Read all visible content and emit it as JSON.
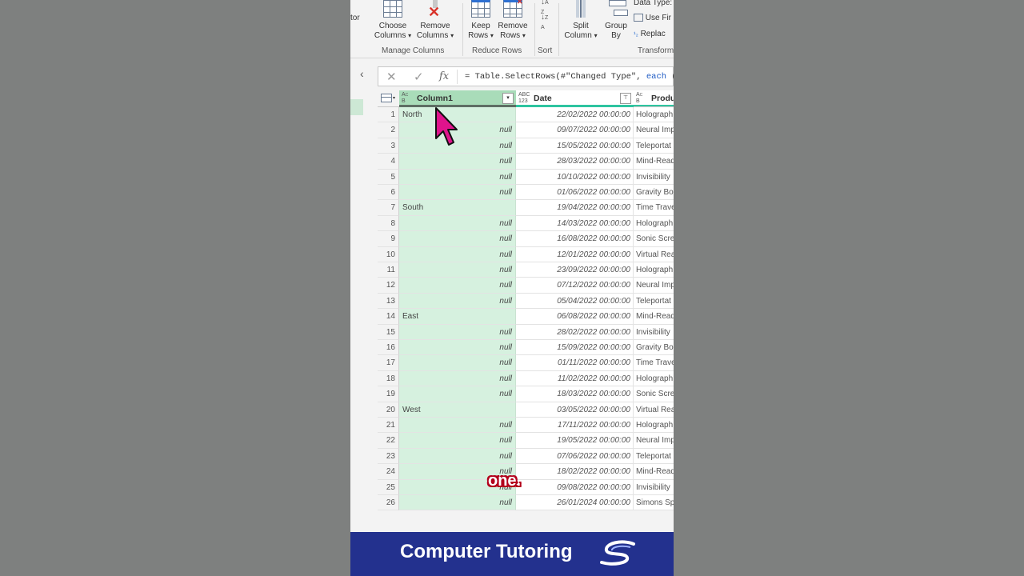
{
  "ribbon": {
    "partial_left": "tor",
    "choose_columns": [
      "Choose",
      "Columns"
    ],
    "remove_columns": [
      "Remove",
      "Columns"
    ],
    "keep_rows": [
      "Keep",
      "Rows"
    ],
    "remove_rows": [
      "Remove",
      "Rows"
    ],
    "split_column": [
      "Split",
      "Column"
    ],
    "group_by": [
      "Group",
      "By"
    ],
    "data_type": "Data Type:",
    "use_first": "Use Fir",
    "replace": "Replac",
    "groups": {
      "manage_columns": "Manage Columns",
      "reduce_rows": "Reduce Rows",
      "sort": "Sort",
      "transform": "Transform"
    }
  },
  "formula": {
    "prefix": "= Table.SelectRows(#\"Changed Type\", ",
    "keyword": "each",
    "suffix": " ("
  },
  "columns": {
    "col1": {
      "type_top": "A",
      "type_bottom": "B",
      "type_mid": "C",
      "name": "Column1"
    },
    "date": {
      "type_top": "ABC",
      "type_bottom": "123",
      "name": "Date"
    },
    "product": {
      "type_top": "A",
      "type_bottom": "B",
      "type_mid": "C",
      "name": "Produ"
    }
  },
  "rows": [
    {
      "n": "1",
      "region": "North",
      "date": "22/02/2022 00:00:00",
      "product": "Holograph"
    },
    {
      "n": "2",
      "region": null,
      "date": "09/07/2022 00:00:00",
      "product": "Neural Imp"
    },
    {
      "n": "3",
      "region": null,
      "date": "15/05/2022 00:00:00",
      "product": "Teleportat"
    },
    {
      "n": "4",
      "region": null,
      "date": "28/03/2022 00:00:00",
      "product": "Mind-Read"
    },
    {
      "n": "5",
      "region": null,
      "date": "10/10/2022 00:00:00",
      "product": "Invisibility"
    },
    {
      "n": "6",
      "region": null,
      "date": "01/06/2022 00:00:00",
      "product": "Gravity Bo"
    },
    {
      "n": "7",
      "region": "South",
      "date": "19/04/2022 00:00:00",
      "product": "Time Trave"
    },
    {
      "n": "8",
      "region": null,
      "date": "14/03/2022 00:00:00",
      "product": "Holograph"
    },
    {
      "n": "9",
      "region": null,
      "date": "16/08/2022 00:00:00",
      "product": "Sonic Scre"
    },
    {
      "n": "10",
      "region": null,
      "date": "12/01/2022 00:00:00",
      "product": "Virtual Rea"
    },
    {
      "n": "11",
      "region": null,
      "date": "23/09/2022 00:00:00",
      "product": "Holograph"
    },
    {
      "n": "12",
      "region": null,
      "date": "07/12/2022 00:00:00",
      "product": "Neural Imp"
    },
    {
      "n": "13",
      "region": null,
      "date": "05/04/2022 00:00:00",
      "product": "Teleportat"
    },
    {
      "n": "14",
      "region": "East",
      "date": "06/08/2022 00:00:00",
      "product": "Mind-Read"
    },
    {
      "n": "15",
      "region": null,
      "date": "28/02/2022 00:00:00",
      "product": "Invisibility"
    },
    {
      "n": "16",
      "region": null,
      "date": "15/09/2022 00:00:00",
      "product": "Gravity Bo"
    },
    {
      "n": "17",
      "region": null,
      "date": "01/11/2022 00:00:00",
      "product": "Time Trave"
    },
    {
      "n": "18",
      "region": null,
      "date": "11/02/2022 00:00:00",
      "product": "Holograph"
    },
    {
      "n": "19",
      "region": null,
      "date": "18/03/2022 00:00:00",
      "product": "Sonic Scre"
    },
    {
      "n": "20",
      "region": "West",
      "date": "03/05/2022 00:00:00",
      "product": "Virtual Rea"
    },
    {
      "n": "21",
      "region": null,
      "date": "17/11/2022 00:00:00",
      "product": "Holograph"
    },
    {
      "n": "22",
      "region": null,
      "date": "19/05/2022 00:00:00",
      "product": "Neural Imp"
    },
    {
      "n": "23",
      "region": null,
      "date": "07/06/2022 00:00:00",
      "product": "Teleportat"
    },
    {
      "n": "24",
      "region": null,
      "date": "18/02/2022 00:00:00",
      "product": "Mind-Read"
    },
    {
      "n": "25",
      "region": null,
      "date": "09/08/2022 00:00:00",
      "product": "Invisibility"
    },
    {
      "n": "26",
      "region": null,
      "date": "26/01/2024 00:00:00",
      "product": "Simons Sp"
    }
  ],
  "null_text": "null",
  "caption": "one.",
  "banner": {
    "text": "Computer Tutoring"
  },
  "colors": {
    "selected_column": "#d6f1df",
    "banner": "#23318e",
    "cursor": "#e0138c",
    "caption_outline": "#b3001b"
  },
  "icons": [
    "choose-columns-icon",
    "remove-columns-icon",
    "keep-rows-icon",
    "remove-rows-icon",
    "sort-asc-icon",
    "sort-desc-icon",
    "split-column-icon",
    "group-by-icon",
    "cancel-icon",
    "check-icon",
    "fx-icon",
    "table-menu-icon",
    "filter-icon",
    "mouse-cursor-icon",
    "brand-logo-icon"
  ]
}
